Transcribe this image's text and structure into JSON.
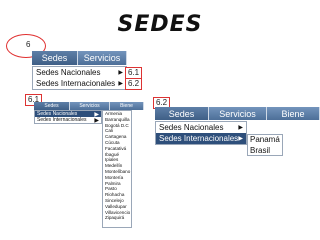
{
  "page_title": "SEDES",
  "markers": {
    "main": "6",
    "submenu_a": "6.1",
    "submenu_b": "6.2",
    "panel_a": "6.1",
    "panel_b": "6.2"
  },
  "menu": {
    "tab_sedes": "Sedes",
    "tab_servicios": "Servicios",
    "tab_bienes": "Biene",
    "tab_bienes_small": "Biene"
  },
  "dropdown": {
    "nacionales": "Sedes Nacionales",
    "internacionales": "Sedes Internacionales",
    "arrow": "▶"
  },
  "cities": [
    "Armenia",
    "Barranquilla",
    "Bogotá D.C",
    "Cali",
    "Cartagena",
    "Cúcuta",
    "Facatativá",
    "Ibagué",
    "Ipiales",
    "Medellín",
    "Montelíbano",
    "Montería",
    "Palmira",
    "Pasto",
    "Riohacha",
    "Sincelejo",
    "Valledupar",
    "Villavicencio",
    "Zipaquirá"
  ],
  "countries": [
    "Panamá",
    "Brasil"
  ],
  "colors": {
    "menubar": "#5a7ea8",
    "selected": "#2e4f7b",
    "marker_border": "#dd3333"
  }
}
